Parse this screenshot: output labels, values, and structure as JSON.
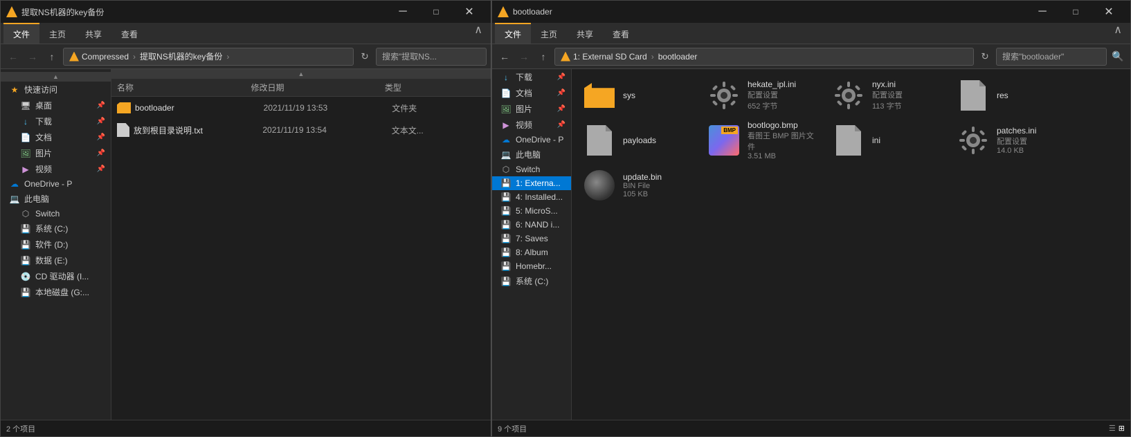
{
  "left_window": {
    "title": "提取NS机器的key备份",
    "tabs": [
      "文件",
      "主页",
      "共享",
      "查看"
    ],
    "active_tab": "文件",
    "address_path": [
      "Compressed",
      "提取NS机器的key备份"
    ],
    "search_placeholder": "搜索\"提取NS...",
    "files": [
      {
        "name": "bootloader",
        "date": "2021/11/19 13:53",
        "type": "文件夹",
        "size": "",
        "icon": "folder"
      },
      {
        "name": "放到根目录说明.txt",
        "date": "2021/11/19 13:54",
        "type": "文本文...",
        "size": "",
        "icon": "txt"
      }
    ],
    "col_headers": [
      "名称",
      "修改日期",
      "类型"
    ],
    "status": "2 个项目"
  },
  "left_sidebar": {
    "quick_access_label": "快速访问",
    "items": [
      {
        "name": "桌面",
        "icon": "desktop",
        "pinned": true
      },
      {
        "name": "下载",
        "icon": "download",
        "pinned": true
      },
      {
        "name": "文档",
        "icon": "document",
        "pinned": true
      },
      {
        "name": "图片",
        "icon": "picture",
        "pinned": true
      },
      {
        "name": "视频",
        "icon": "video",
        "pinned": true
      }
    ],
    "onedrive": "OneDrive - P",
    "this_pc": "此电脑",
    "pc_items": [
      {
        "name": "Switch",
        "icon": "switch"
      },
      {
        "name": "系统 (C:)",
        "icon": "disk"
      },
      {
        "name": "软件 (D:)",
        "icon": "disk"
      },
      {
        "name": "数据 (E:)",
        "icon": "disk"
      },
      {
        "name": "CD 驱动器 (I...",
        "icon": "cd"
      },
      {
        "name": "本地磁盘 (G:...",
        "icon": "disk"
      }
    ]
  },
  "right_window": {
    "title": "bootloader",
    "tabs": [
      "文件",
      "主页",
      "共享",
      "查看"
    ],
    "active_tab": "文件",
    "address_path": [
      "1: External SD Card",
      "bootloader"
    ],
    "search_placeholder": "搜索\"bootloader\"",
    "status": "9 个项目",
    "files": [
      {
        "name": "sys",
        "sub": "",
        "size": "",
        "icon": "folder"
      },
      {
        "name": "hekate_ipl.ini",
        "sub": "配置设置",
        "size": "652 字节",
        "icon": "gear"
      },
      {
        "name": "nyx.ini",
        "sub": "配置设置",
        "size": "113 字节",
        "icon": "gear"
      },
      {
        "name": "res",
        "sub": "",
        "size": "",
        "icon": "doc"
      },
      {
        "name": "payloads",
        "sub": "",
        "size": "",
        "icon": "doc"
      },
      {
        "name": "bootlogo.bmp",
        "sub": "看图王 BMP 图片文件",
        "size": "3.51 MB",
        "icon": "bmp"
      },
      {
        "name": "ini",
        "sub": "",
        "size": "",
        "icon": "doc"
      },
      {
        "name": "patches.ini",
        "sub": "配置设置",
        "size": "14.0 KB",
        "icon": "gear"
      },
      {
        "name": "update.bin",
        "sub": "BIN File",
        "size": "105 KB",
        "icon": "bin"
      }
    ]
  },
  "right_sidebar": {
    "items": [
      {
        "name": "下载",
        "icon": "download",
        "pinned": true
      },
      {
        "name": "文档",
        "icon": "document",
        "pinned": true
      },
      {
        "name": "图片",
        "icon": "picture",
        "pinned": true
      },
      {
        "name": "视频",
        "icon": "video",
        "pinned": true
      },
      {
        "name": "OneDrive - P",
        "icon": "onedrive"
      },
      {
        "name": "此电脑",
        "icon": "pc"
      },
      {
        "name": "Switch",
        "icon": "switch"
      },
      {
        "name": "1: Externa...",
        "icon": "sd",
        "active": true
      },
      {
        "name": "4: Installed...",
        "icon": "sd"
      },
      {
        "name": "5: MicroS...",
        "icon": "sd"
      },
      {
        "name": "6: NAND i...",
        "icon": "sd"
      },
      {
        "name": "7: Saves",
        "icon": "sd"
      },
      {
        "name": "8: Album",
        "icon": "sd"
      },
      {
        "name": "Homebr...",
        "icon": "sd"
      },
      {
        "name": "系统 (C:)",
        "icon": "disk"
      }
    ]
  }
}
